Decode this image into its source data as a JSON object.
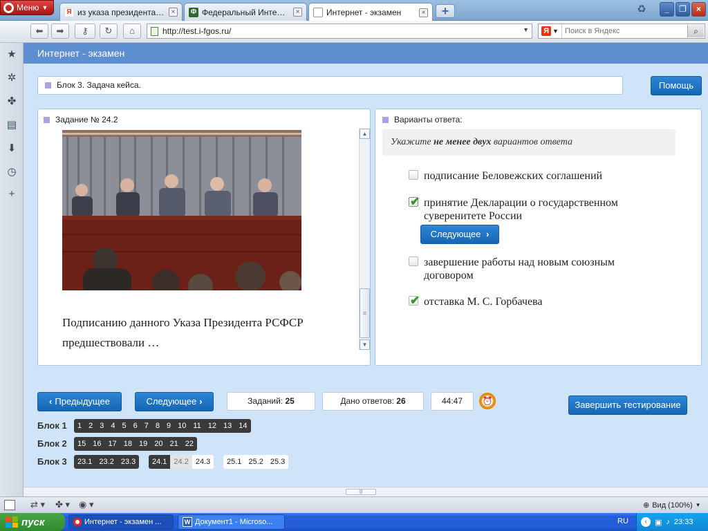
{
  "browser": {
    "menu_label": "Меню",
    "tabs": [
      {
        "title": "из указа президента р...",
        "favicon": "Я"
      },
      {
        "title": "Федеральный Интерне...",
        "favicon": "Ф"
      },
      {
        "title": "Интернет - экзамен",
        "favicon": "□"
      }
    ],
    "url": "http://test.i-fgos.ru/",
    "search_placeholder": "Поиск в Яндекс",
    "search_engine_letter": "Я"
  },
  "page": {
    "header_title": "Интернет - экзамен",
    "block_title": "Блок 3. Задача кейса.",
    "help_label": "Помощь",
    "task_title": "Задание № 24.2",
    "question": "Подписанию данного Указа Президента РСФСР предшествовали …",
    "answers_title": "Варианты ответа:",
    "instruction": {
      "pre": "Укажите ",
      "bold": "не менее двух",
      "post": " вариантов ответа"
    },
    "options": [
      {
        "text": "подписание Беловежских соглашений",
        "checked": false
      },
      {
        "text": "принятие Декларации о государственном суверенитете России",
        "checked": true
      },
      {
        "text": "завершение работы над новым союзным договором",
        "checked": false
      },
      {
        "text": "отставка М. С. Горбачева",
        "checked": true
      }
    ],
    "inline_next_label": "Следующее",
    "prev_label": "Предыдущее",
    "next_label": "Следующее",
    "tasks_label": "Заданий:",
    "tasks_count": "25",
    "answered_label": "Дано ответов:",
    "answered_count": "26",
    "timer": "44:47",
    "finish_label": "Завершить тестирование",
    "blocks": [
      {
        "label": "Блок 1",
        "groups": [
          {
            "style": "dark",
            "items": [
              "1",
              "2",
              "3",
              "4",
              "5",
              "6",
              "7",
              "8",
              "9",
              "10",
              "11",
              "12",
              "13",
              "14"
            ]
          }
        ]
      },
      {
        "label": "Блок 2",
        "groups": [
          {
            "style": "dark",
            "items": [
              "15",
              "16",
              "17",
              "18",
              "19",
              "20",
              "21",
              "22"
            ]
          }
        ]
      },
      {
        "label": "Блок 3",
        "groups": [
          {
            "style": "dark",
            "items": [
              "23.1",
              "23.2",
              "23.3"
            ]
          },
          {
            "style": "mixed",
            "items": [
              "24.1",
              "24.2",
              "24.3"
            ]
          },
          {
            "style": "light",
            "items": [
              "25.1",
              "25.2",
              "25.3"
            ]
          }
        ]
      }
    ]
  },
  "statusbar": {
    "zoom": "Вид (100%)"
  },
  "taskbar": {
    "start_label": "пуск",
    "tasks": [
      "Интернет - экзамен ...",
      "Документ1 - Microso..."
    ],
    "lang": "RU",
    "clock": "23:33"
  },
  "colors": {
    "page_bg": "#cfe4f8",
    "header_bar": "#5d8fd0",
    "primary_button": "#1f77c8",
    "chip_dark": "#3a3a3a",
    "check_green": "#2f9a25"
  }
}
